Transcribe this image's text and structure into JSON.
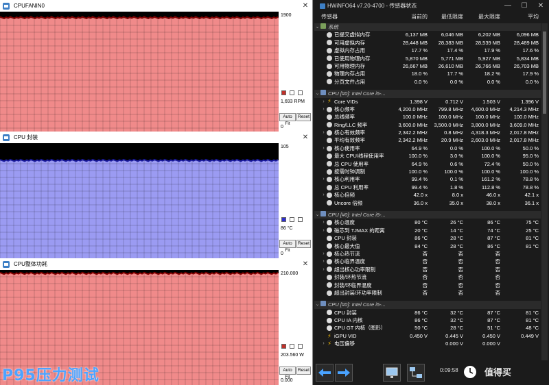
{
  "graphs": [
    {
      "title": "CPUFANIN0",
      "top_value": "1900",
      "current": "1,693 RPM",
      "bottom_value": "0",
      "color": "#f08a8a",
      "line": "#800000",
      "level": 0.95,
      "btn_fit": "Auto Fit",
      "btn_reset": "Reset",
      "squares": [
        "#c0302a",
        "#ffffff",
        "#ffffff"
      ]
    },
    {
      "title": "CPU 封装",
      "top_value": "105",
      "current": "86 °C",
      "bottom_value": "0",
      "color": "#9b9bf2",
      "line": "#1a1aa0",
      "level": 0.85,
      "btn_fit": "Auto Fit",
      "btn_reset": "Reset",
      "squares": [
        "#3030d0",
        "#ffffff",
        "#ffffff"
      ]
    },
    {
      "title": "CPU整体功耗",
      "top_value": "210.000",
      "current": "203.560 W",
      "bottom_value": "0.000",
      "color": "#f08a8a",
      "line": "#800000",
      "level": 0.97,
      "btn_fit": "Auto Fit",
      "btn_reset": "Reset",
      "squares": [
        "#c0302a",
        "#ffffff",
        "#ffffff"
      ]
    }
  ],
  "overlay_label": "P95压力测试",
  "hwinfo": {
    "title": "HWiNFO64 v7.20-4700 - 传感器状态",
    "columns": {
      "sensor": "传感器",
      "current": "当前的",
      "min": "最低限度",
      "max": "最大限度",
      "avg": "平均"
    },
    "rows": [
      {
        "type": "group",
        "name": "系统",
        "icon": "mem"
      },
      {
        "name": "已提交虚拟内存",
        "cur": "6,137 MB",
        "min": "6,046 MB",
        "max": "6,202 MB",
        "avg": "6,096 MB",
        "icon": "dot"
      },
      {
        "name": "可用虚拟内存",
        "cur": "28,448 MB",
        "min": "28,383 MB",
        "max": "28,539 MB",
        "avg": "28,489 MB",
        "icon": "dot"
      },
      {
        "name": "虚拟内存占用",
        "cur": "17.7 %",
        "min": "17.4 %",
        "max": "17.9 %",
        "avg": "17.6 %",
        "icon": "dot"
      },
      {
        "name": "已使用物理内存",
        "cur": "5,870 MB",
        "min": "5,771 MB",
        "max": "5,927 MB",
        "avg": "5,834 MB",
        "icon": "dot"
      },
      {
        "name": "可用物理内存",
        "cur": "26,667 MB",
        "min": "26,610 MB",
        "max": "26,766 MB",
        "avg": "26,703 MB",
        "icon": "dot"
      },
      {
        "name": "物理内存占用",
        "cur": "18.0 %",
        "min": "17.7 %",
        "max": "18.2 %",
        "avg": "17.9 %",
        "icon": "dot"
      },
      {
        "name": "分页文件占用",
        "cur": "0.0 %",
        "min": "0.0 %",
        "max": "0.0 %",
        "avg": "0.0 %",
        "icon": "dot"
      },
      {
        "type": "sep"
      },
      {
        "type": "group",
        "name": "CPU [#0]: Intel Core i5-...",
        "icon": "cpu"
      },
      {
        "name": "Core VIDs",
        "cur": "1.398 V",
        "min": "0.712 V",
        "max": "1.503 V",
        "avg": "1.396 V",
        "icon": "bolt",
        "exp": "›"
      },
      {
        "name": "核心频率",
        "cur": "4,200.0 MHz",
        "min": "799.8 MHz",
        "max": "4,600.0 MHz",
        "avg": "4,214.3 MHz",
        "icon": "dot",
        "exp": "›"
      },
      {
        "name": "总线频率",
        "cur": "100.0 MHz",
        "min": "100.0 MHz",
        "max": "100.0 MHz",
        "avg": "100.0 MHz",
        "icon": "dot"
      },
      {
        "name": "Ring/LLC 频率",
        "cur": "3,600.0 MHz",
        "min": "3,500.0 MHz",
        "max": "3,800.0 MHz",
        "avg": "3,609.0 MHz",
        "icon": "dot"
      },
      {
        "name": "核心有效频率",
        "cur": "2,342.2 MHz",
        "min": "0.8 MHz",
        "max": "4,318.3 MHz",
        "avg": "2,017.8 MHz",
        "icon": "dot",
        "exp": "›"
      },
      {
        "name": "平均有效频率",
        "cur": "2,342.2 MHz",
        "min": "20.9 MHz",
        "max": "2,603.0 MHz",
        "avg": "2,017.8 MHz",
        "icon": "dot"
      },
      {
        "name": "核心使用率",
        "cur": "64.9 %",
        "min": "0.0 %",
        "max": "100.0 %",
        "avg": "50.0 %",
        "icon": "dot",
        "exp": "›"
      },
      {
        "name": "最大 CPU/线程使用率",
        "cur": "100.0 %",
        "min": "3.0 %",
        "max": "100.0 %",
        "avg": "95.0 %",
        "icon": "dot"
      },
      {
        "name": "总 CPU 使用率",
        "cur": "64.9 %",
        "min": "0.6 %",
        "max": "72.4 %",
        "avg": "50.0 %",
        "icon": "dot"
      },
      {
        "name": "按需时钟调制",
        "cur": "100.0 %",
        "min": "100.0 %",
        "max": "100.0 %",
        "avg": "100.0 %",
        "icon": "dot"
      },
      {
        "name": "核心利用率",
        "cur": "99.4 %",
        "min": "0.1 %",
        "max": "161.2 %",
        "avg": "78.8 %",
        "icon": "dot",
        "exp": "›"
      },
      {
        "name": "总 CPU 利用率",
        "cur": "99.4 %",
        "min": "1.8 %",
        "max": "112.8 %",
        "avg": "78.8 %",
        "icon": "dot"
      },
      {
        "name": "核心倍频",
        "cur": "42.0 x",
        "min": "8.0 x",
        "max": "46.0 x",
        "avg": "42.1 x",
        "icon": "dot",
        "exp": "›"
      },
      {
        "name": "Uncore 倍频",
        "cur": "36.0 x",
        "min": "35.0 x",
        "max": "38.0 x",
        "avg": "36.1 x",
        "icon": "dot"
      },
      {
        "type": "sep"
      },
      {
        "type": "group",
        "name": "CPU [#0]: Intel Core i5-...",
        "icon": "cpu"
      },
      {
        "name": "核心温度",
        "cur": "80 °C",
        "min": "26 °C",
        "max": "86 °C",
        "avg": "75 °C",
        "icon": "therm",
        "exp": "›"
      },
      {
        "name": "磁芯到 TJMAX 的距离",
        "cur": "20 °C",
        "min": "14 °C",
        "max": "74 °C",
        "avg": "25 °C",
        "icon": "therm",
        "exp": "›"
      },
      {
        "name": "CPU 封装",
        "cur": "86 °C",
        "min": "28 °C",
        "max": "87 °C",
        "avg": "81 °C",
        "icon": "therm"
      },
      {
        "name": "核心最大值",
        "cur": "84 °C",
        "min": "28 °C",
        "max": "86 °C",
        "avg": "81 °C",
        "icon": "therm"
      },
      {
        "name": "核心热节流",
        "cur": "否",
        "min": "否",
        "max": "否",
        "avg": "",
        "icon": "dot",
        "exp": "›"
      },
      {
        "name": "核心临界温度",
        "cur": "否",
        "min": "否",
        "max": "否",
        "avg": "",
        "icon": "dot",
        "exp": "›"
      },
      {
        "name": "超出核心功率限制",
        "cur": "否",
        "min": "否",
        "max": "否",
        "avg": "",
        "icon": "dot",
        "exp": "›"
      },
      {
        "name": "封装/环热节流",
        "cur": "否",
        "min": "否",
        "max": "否",
        "avg": "",
        "icon": "dot"
      },
      {
        "name": "封装/环临界温度",
        "cur": "否",
        "min": "否",
        "max": "否",
        "avg": "",
        "icon": "dot"
      },
      {
        "name": "超出封装/环功率限制",
        "cur": "否",
        "min": "否",
        "max": "否",
        "avg": "",
        "icon": "dot"
      },
      {
        "type": "sep"
      },
      {
        "type": "group",
        "name": "CPU [#0]: Intel Core i5-...",
        "icon": "cpu"
      },
      {
        "name": "CPU 封装",
        "cur": "86 °C",
        "min": "32 °C",
        "max": "87 °C",
        "avg": "81 °C",
        "icon": "therm"
      },
      {
        "name": "CPU IA 内核",
        "cur": "86 °C",
        "min": "32 °C",
        "max": "87 °C",
        "avg": "81 °C",
        "icon": "therm"
      },
      {
        "name": "CPU GT 内核（图形）",
        "cur": "50 °C",
        "min": "28 °C",
        "max": "51 °C",
        "avg": "48 °C",
        "icon": "therm"
      },
      {
        "name": "iGPU VID",
        "cur": "0.450 V",
        "min": "0.445 V",
        "max": "0.450 V",
        "avg": "0.449 V",
        "icon": "bolt"
      },
      {
        "name": "电压偏移",
        "cur": "",
        "min": "0.000 V",
        "max": "0.000 V",
        "avg": "",
        "icon": "bolt",
        "exp": "›"
      }
    ],
    "clock": "0:09:58",
    "watermark": "值得买"
  }
}
